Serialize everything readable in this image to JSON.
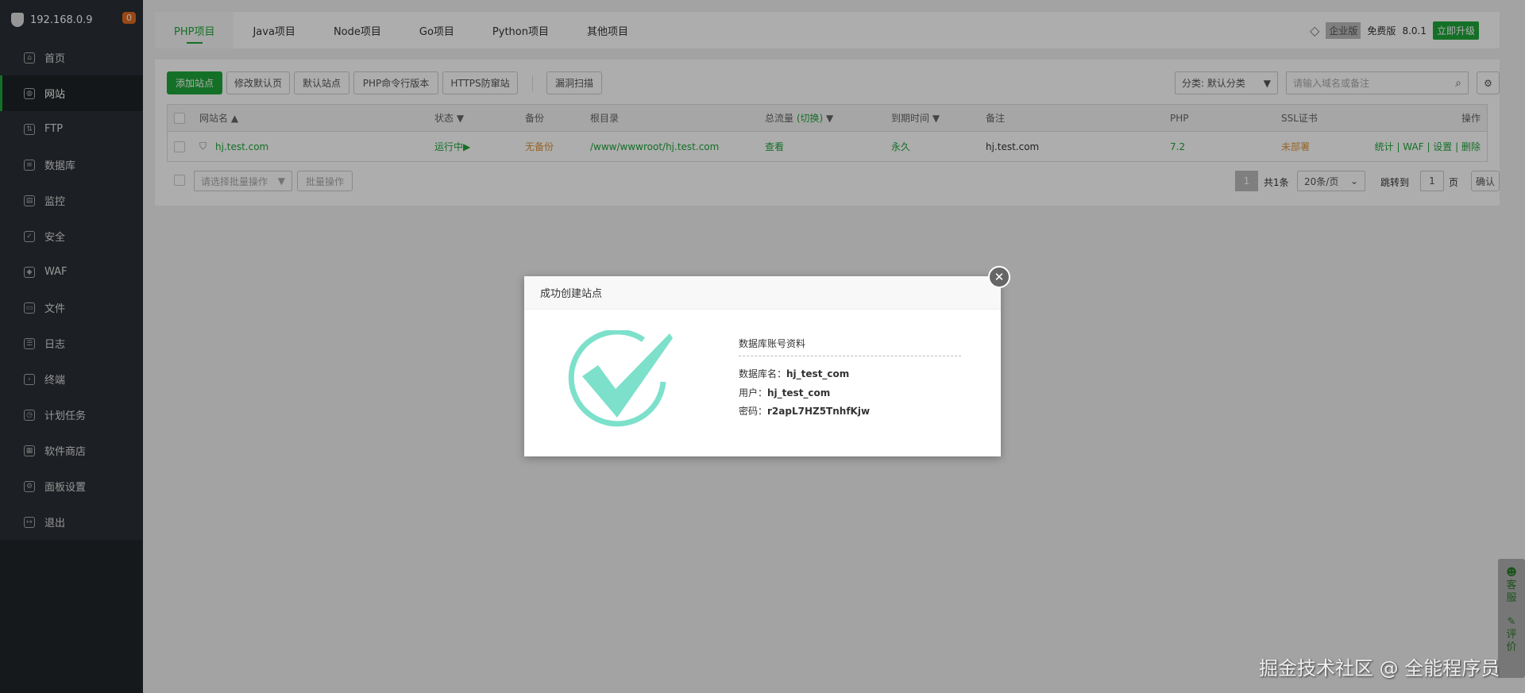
{
  "sidebar": {
    "host": "192.168.0.9",
    "badge": "0",
    "items": [
      {
        "label": "首页",
        "icon": "home-icon"
      },
      {
        "label": "网站",
        "icon": "globe-icon",
        "active": true
      },
      {
        "label": "FTP",
        "icon": "ftp-icon"
      },
      {
        "label": "数据库",
        "icon": "database-icon"
      },
      {
        "label": "监控",
        "icon": "monitor-icon"
      },
      {
        "label": "安全",
        "icon": "shield-icon"
      },
      {
        "label": "WAF",
        "icon": "waf-icon"
      },
      {
        "label": "文件",
        "icon": "folder-icon"
      },
      {
        "label": "日志",
        "icon": "log-icon"
      },
      {
        "label": "终端",
        "icon": "terminal-icon"
      },
      {
        "label": "计划任务",
        "icon": "clock-icon"
      },
      {
        "label": "软件商店",
        "icon": "grid-icon"
      },
      {
        "label": "面板设置",
        "icon": "gear-icon"
      },
      {
        "label": "退出",
        "icon": "logout-icon"
      }
    ]
  },
  "tabs": [
    "PHP项目",
    "Java项目",
    "Node项目",
    "Go项目",
    "Python项目",
    "其他项目"
  ],
  "topright": {
    "enterprise": "企业版",
    "free": "免费版",
    "version": "8.0.1",
    "upgrade": "立即升级"
  },
  "toolbar": {
    "add": "添加站点",
    "modify_default": "修改默认页",
    "default_site": "默认站点",
    "php_cli": "PHP命令行版本",
    "https": "HTTPS防窜站",
    "scan": "漏洞扫描",
    "category": "分类: 默认分类",
    "search_placeholder": "请输入域名或备注"
  },
  "table": {
    "headers": {
      "name": "网站名",
      "status": "状态",
      "backup": "备份",
      "root": "根目录",
      "traffic": "总流量",
      "traffic_switch": "(切换)",
      "expire": "到期时间",
      "note": "备注",
      "php": "PHP",
      "ssl": "SSL证书",
      "ops": "操作"
    },
    "rows": [
      {
        "name": "hj.test.com",
        "status": "运行中▶",
        "backup": "无备份",
        "root": "/www/wwwroot/hj.test.com",
        "traffic": "查看",
        "expire": "永久",
        "note": "hj.test.com",
        "php": "7.2",
        "ssl": "未部署",
        "ops": [
          "统计",
          "WAF",
          "设置",
          "删除"
        ]
      }
    ]
  },
  "footer": {
    "batch_placeholder": "请选择批量操作",
    "batch_btn": "批量操作",
    "page": "1",
    "total": "共1条",
    "per_page": "20条/页",
    "jump": "跳转到",
    "jump_value": "1",
    "page_unit": "页",
    "confirm": "确认"
  },
  "modal": {
    "title": "成功创建站点",
    "section": "数据库账号资料",
    "db_label": "数据库名：",
    "db": "hj_test_com",
    "user_label": "用户：",
    "user": "hj_test_com",
    "pass_label": "密码：",
    "pass": "r2apL7HZ5TnhfKjw"
  },
  "float": {
    "service": "客服",
    "review": "评价"
  },
  "watermark": "掘金技术社区 @ 全能程序员",
  "colors": {
    "accent": "#20a53a",
    "warning": "#e0953a",
    "check": "#7de0cb"
  }
}
